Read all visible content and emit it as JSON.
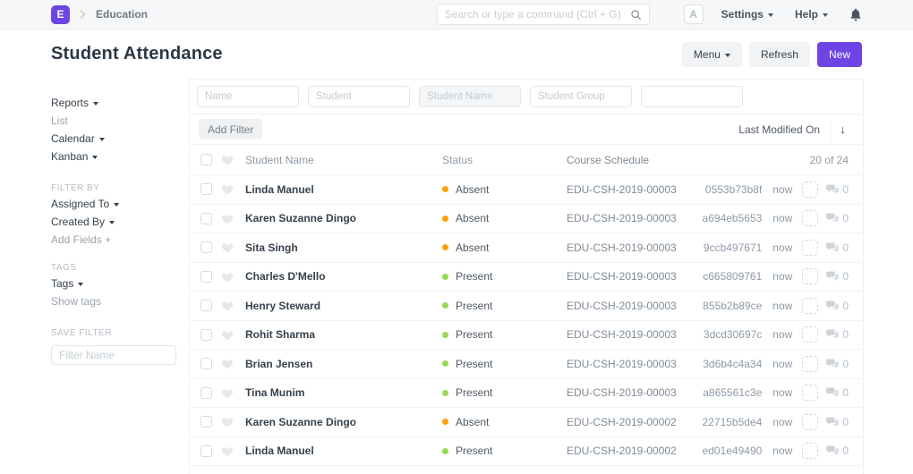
{
  "colors": {
    "accent": "#6e45e4",
    "status": {
      "Absent": "#ffa00a",
      "Present": "#99d857"
    }
  },
  "navbar": {
    "logo_letter": "E",
    "breadcrumb": "Education",
    "search_placeholder": "Search or type a command (Ctrl + G)",
    "avatar_letter": "A",
    "settings_label": "Settings",
    "help_label": "Help"
  },
  "page_header": {
    "title": "Student Attendance",
    "menu_label": "Menu",
    "refresh_label": "Refresh",
    "new_label": "New"
  },
  "sidebar": {
    "views": [
      {
        "label": "Reports",
        "caret": true,
        "muted": false
      },
      {
        "label": "List",
        "caret": false,
        "muted": true
      },
      {
        "label": "Calendar",
        "caret": true,
        "muted": false
      },
      {
        "label": "Kanban",
        "caret": true,
        "muted": false
      }
    ],
    "filter_by_heading": "FILTER BY",
    "filter_items": [
      {
        "label": "Assigned To",
        "caret": true,
        "muted": false
      },
      {
        "label": "Created By",
        "caret": true,
        "muted": false
      },
      {
        "label": "Add Fields +",
        "caret": false,
        "muted": true
      }
    ],
    "tags_heading": "TAGS",
    "tag_items": [
      {
        "label": "Tags",
        "caret": true,
        "muted": false
      },
      {
        "label": "Show tags",
        "caret": false,
        "muted": true
      }
    ],
    "save_filter_heading": "SAVE FILTER",
    "filter_name_placeholder": "Filter Name"
  },
  "filters": {
    "inputs": [
      {
        "placeholder": "Name",
        "tinted": false
      },
      {
        "placeholder": "Student",
        "tinted": false
      },
      {
        "placeholder": "Student Name",
        "tinted": true
      },
      {
        "placeholder": "Student Group",
        "tinted": false
      },
      {
        "placeholder": "",
        "tinted": false
      }
    ],
    "add_filter_label": "Add Filter",
    "sort_label": "Last Modified On",
    "sort_icon": "↓"
  },
  "list": {
    "header": {
      "name": "Student Name",
      "status": "Status",
      "schedule": "Course Schedule",
      "count": "20 of 24"
    },
    "rows": [
      {
        "name": "Linda Manuel",
        "status": "Absent",
        "schedule": "EDU-CSH-2019-00003",
        "id": "0553b73b8f",
        "modified": "now",
        "comments": "0"
      },
      {
        "name": "Karen Suzanne Dingo",
        "status": "Absent",
        "schedule": "EDU-CSH-2019-00003",
        "id": "a694eb5653",
        "modified": "now",
        "comments": "0"
      },
      {
        "name": "Sita Singh",
        "status": "Absent",
        "schedule": "EDU-CSH-2019-00003",
        "id": "9ccb497671",
        "modified": "now",
        "comments": "0"
      },
      {
        "name": "Charles D'Mello",
        "status": "Present",
        "schedule": "EDU-CSH-2019-00003",
        "id": "c665809761",
        "modified": "now",
        "comments": "0"
      },
      {
        "name": "Henry Steward",
        "status": "Present",
        "schedule": "EDU-CSH-2019-00003",
        "id": "855b2b89ce",
        "modified": "now",
        "comments": "0"
      },
      {
        "name": "Rohit Sharma",
        "status": "Present",
        "schedule": "EDU-CSH-2019-00003",
        "id": "3dcd30697c",
        "modified": "now",
        "comments": "0"
      },
      {
        "name": "Brian Jensen",
        "status": "Present",
        "schedule": "EDU-CSH-2019-00003",
        "id": "3d6b4c4a34",
        "modified": "now",
        "comments": "0"
      },
      {
        "name": "Tina Munim",
        "status": "Present",
        "schedule": "EDU-CSH-2019-00003",
        "id": "a865561c3e",
        "modified": "now",
        "comments": "0"
      },
      {
        "name": "Karen Suzanne Dingo",
        "status": "Absent",
        "schedule": "EDU-CSH-2019-00002",
        "id": "22715b5de4",
        "modified": "now",
        "comments": "0"
      },
      {
        "name": "Linda Manuel",
        "status": "Present",
        "schedule": "EDU-CSH-2019-00002",
        "id": "ed01e49490",
        "modified": "now",
        "comments": "0"
      }
    ]
  }
}
